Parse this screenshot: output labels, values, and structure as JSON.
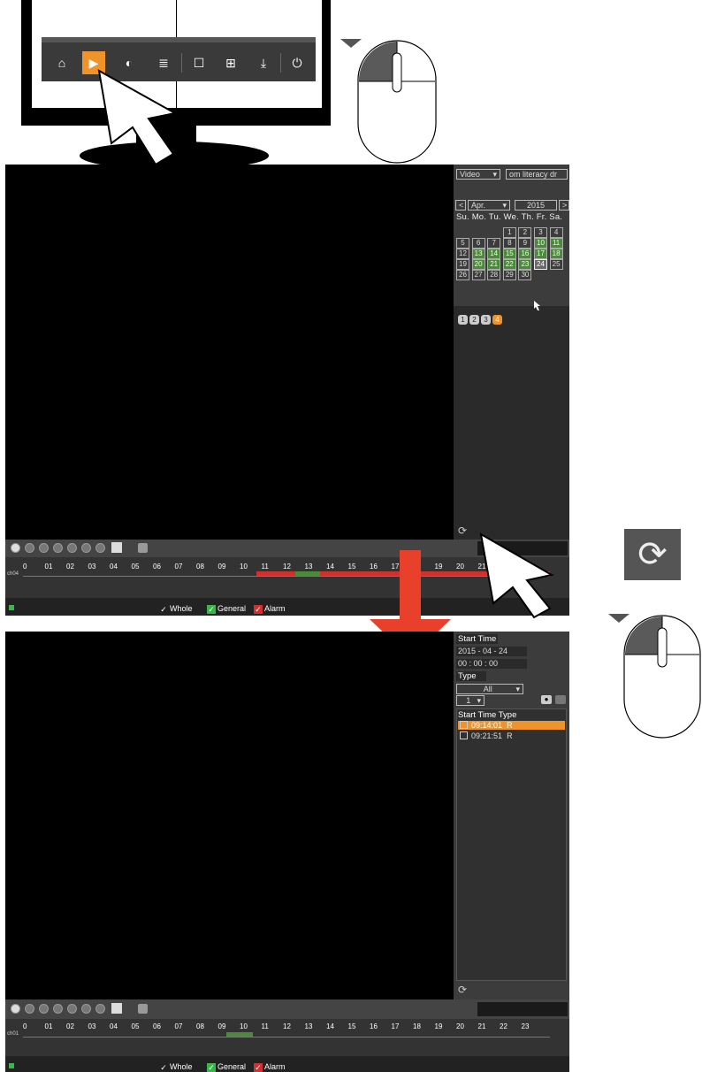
{
  "toolbar": {
    "buttons": [
      {
        "name": "home",
        "glyph": "⌂"
      },
      {
        "name": "playback",
        "glyph": "▶"
      },
      {
        "name": "color",
        "glyph": "◐"
      },
      {
        "name": "list",
        "glyph": "≣"
      },
      {
        "name": "single-view",
        "glyph": "☐"
      },
      {
        "name": "quad-view",
        "glyph": "⊞"
      },
      {
        "name": "download",
        "glyph": "⤓"
      },
      {
        "name": "power",
        "glyph": "⏻"
      }
    ]
  },
  "playback1": {
    "record_type": "Video",
    "device": "om literacy dr",
    "month": "Apr.",
    "year": "2015",
    "prev": "<",
    "next": ">",
    "weekdays": "Su. Mo. Tu. We. Th. Fr. Sa.",
    "days": [
      "1",
      "2",
      "3",
      "4",
      "5",
      "6",
      "7",
      "8",
      "9",
      "10",
      "11",
      "12",
      "13",
      "14",
      "15",
      "16",
      "17",
      "18",
      "19",
      "20",
      "21",
      "22",
      "23",
      "24",
      "25",
      "26",
      "27",
      "28",
      "29",
      "30"
    ],
    "channels": [
      "1",
      "2",
      "3",
      "4"
    ],
    "channel_label": "ch04"
  },
  "hours": [
    "0",
    "01",
    "02",
    "03",
    "04",
    "05",
    "06",
    "07",
    "08",
    "09",
    "10",
    "11",
    "12",
    "13",
    "14",
    "15",
    "16",
    "17",
    "18",
    "19",
    "20",
    "21",
    "22",
    "23"
  ],
  "legend": {
    "whole": "Whole",
    "general": "General",
    "alarm": "Alarm",
    "check": "✓"
  },
  "playback2": {
    "start_time_label": "Start Time",
    "date": "2015  - 04 - 24",
    "time": "00 : 00 : 00",
    "type_label": "Type",
    "type_value": "All",
    "channel_value": "1",
    "list_header": "Start Time Type",
    "files": [
      {
        "time": "09:14:01",
        "type": "R"
      },
      {
        "time": "09:21:51",
        "type": "R"
      }
    ],
    "channel_label": "ch01"
  },
  "colors": {
    "accent": "#f0932b",
    "record": "#4a8a3a",
    "alarm": "#d32f2f",
    "arrow": "#e8402a"
  }
}
